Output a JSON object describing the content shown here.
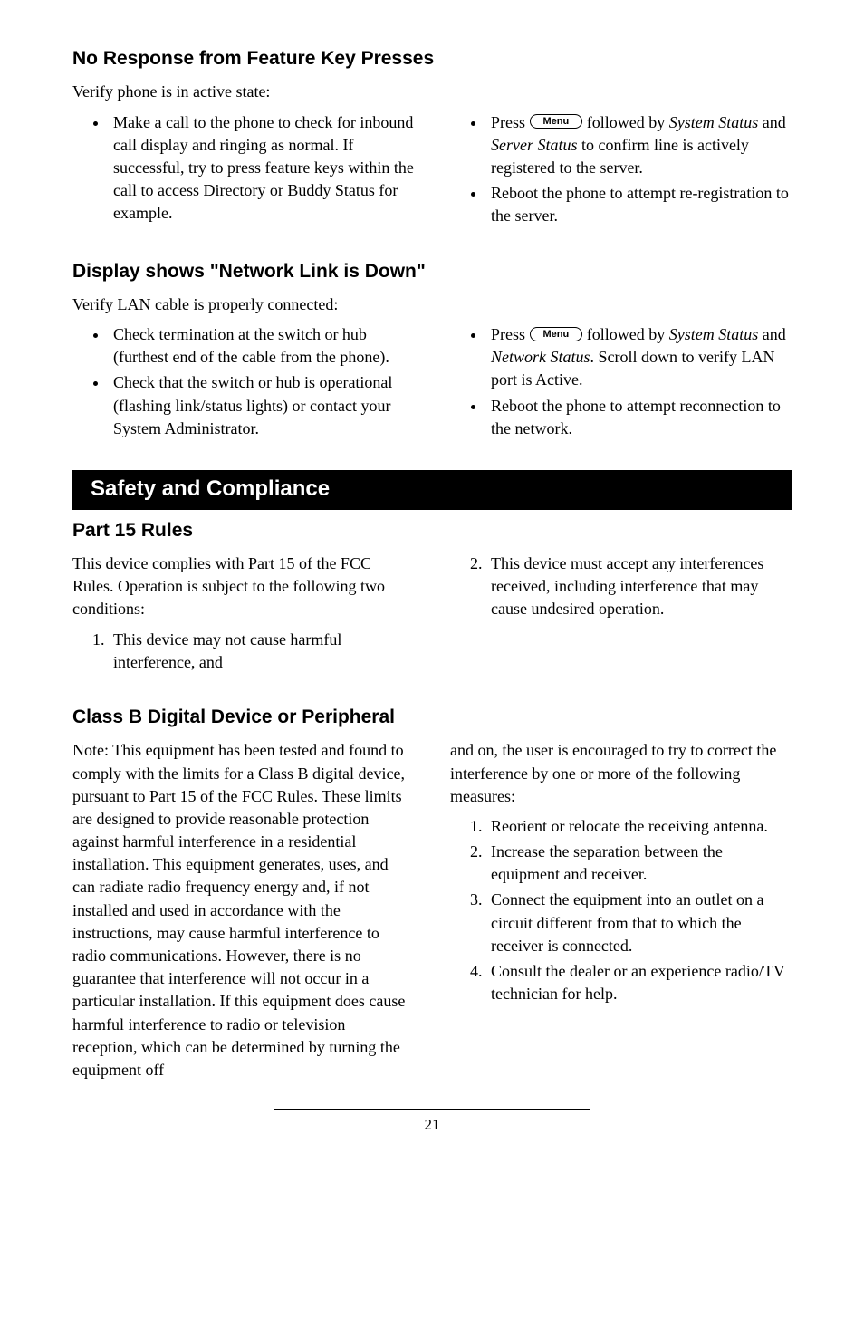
{
  "section1": {
    "heading": "No Response from Feature Key Presses",
    "intro": "Verify phone is in active state:",
    "left_bullet": "Make a call to the phone to check for inbound call display and ringing as normal.  If successful, try to press feature keys within the call to access Directory or Buddy Status for example.",
    "right_bullet1_a": "Press ",
    "right_bullet1_b": " followed by ",
    "right_bullet1_c": "System Status",
    "right_bullet1_d": " and ",
    "right_bullet1_e": "Server Status",
    "right_bullet1_f": " to confirm line is actively registered to the server.",
    "right_bullet2": "Reboot the phone to attempt re-registration to the server.",
    "menu_label": "Menu"
  },
  "section2": {
    "heading": "Display shows \"Network Link is Down\"",
    "intro": "Verify LAN cable is properly connected:",
    "left_b1": "Check termination at the switch or hub (furthest end of the cable from the phone).",
    "left_b2": "Check that the switch or hub is operational (flashing link/status lights) or contact your System Administrator.",
    "right_b1_a": "Press ",
    "right_b1_b": " followed by ",
    "right_b1_c": "System Status",
    "right_b1_d": " and ",
    "right_b1_e": "Network Status",
    "right_b1_f": ".  Scroll down to verify LAN port is Active.",
    "right_b2": "Reboot the phone to attempt reconnection to the network.",
    "menu_label": "Menu"
  },
  "safety_bar": "Safety and Compliance",
  "part15": {
    "heading": "Part 15 Rules",
    "intro": "This device complies with Part 15 of the FCC Rules.  Operation is subject to the following two conditions:",
    "item1": "This device may not cause harmful interference, and",
    "item2": "This device must accept any interferences received, including interference that may cause undesired operation."
  },
  "classb": {
    "heading": "Class B Digital Device or Peripheral",
    "left_para": "Note:  This equipment has been tested and found to comply with the limits for a Class B digital device, pursuant to Part 15 of the FCC Rules.  These limits are designed to provide reasonable protection against harmful interference in a residential installation.  This equipment generates, uses, and can radiate radio frequency energy and, if not installed and used in accordance with the instructions, may cause harmful interference to radio communications.  However, there is no guarantee that interference will not occur in a particular installation.  If this equipment does cause harmful interference to radio or television reception, which can be determined by turning the equipment off",
    "right_intro": "and on, the user is encouraged to try to correct the interference by one or more of the following measures:",
    "m1": "Reorient or relocate the receiving antenna.",
    "m2": "Increase the separation between the equipment and receiver.",
    "m3": "Connect the equipment into an outlet on a circuit different from that to which the receiver is connected.",
    "m4": "Consult the dealer or an experience radio/TV technician for help."
  },
  "page_number": "21"
}
